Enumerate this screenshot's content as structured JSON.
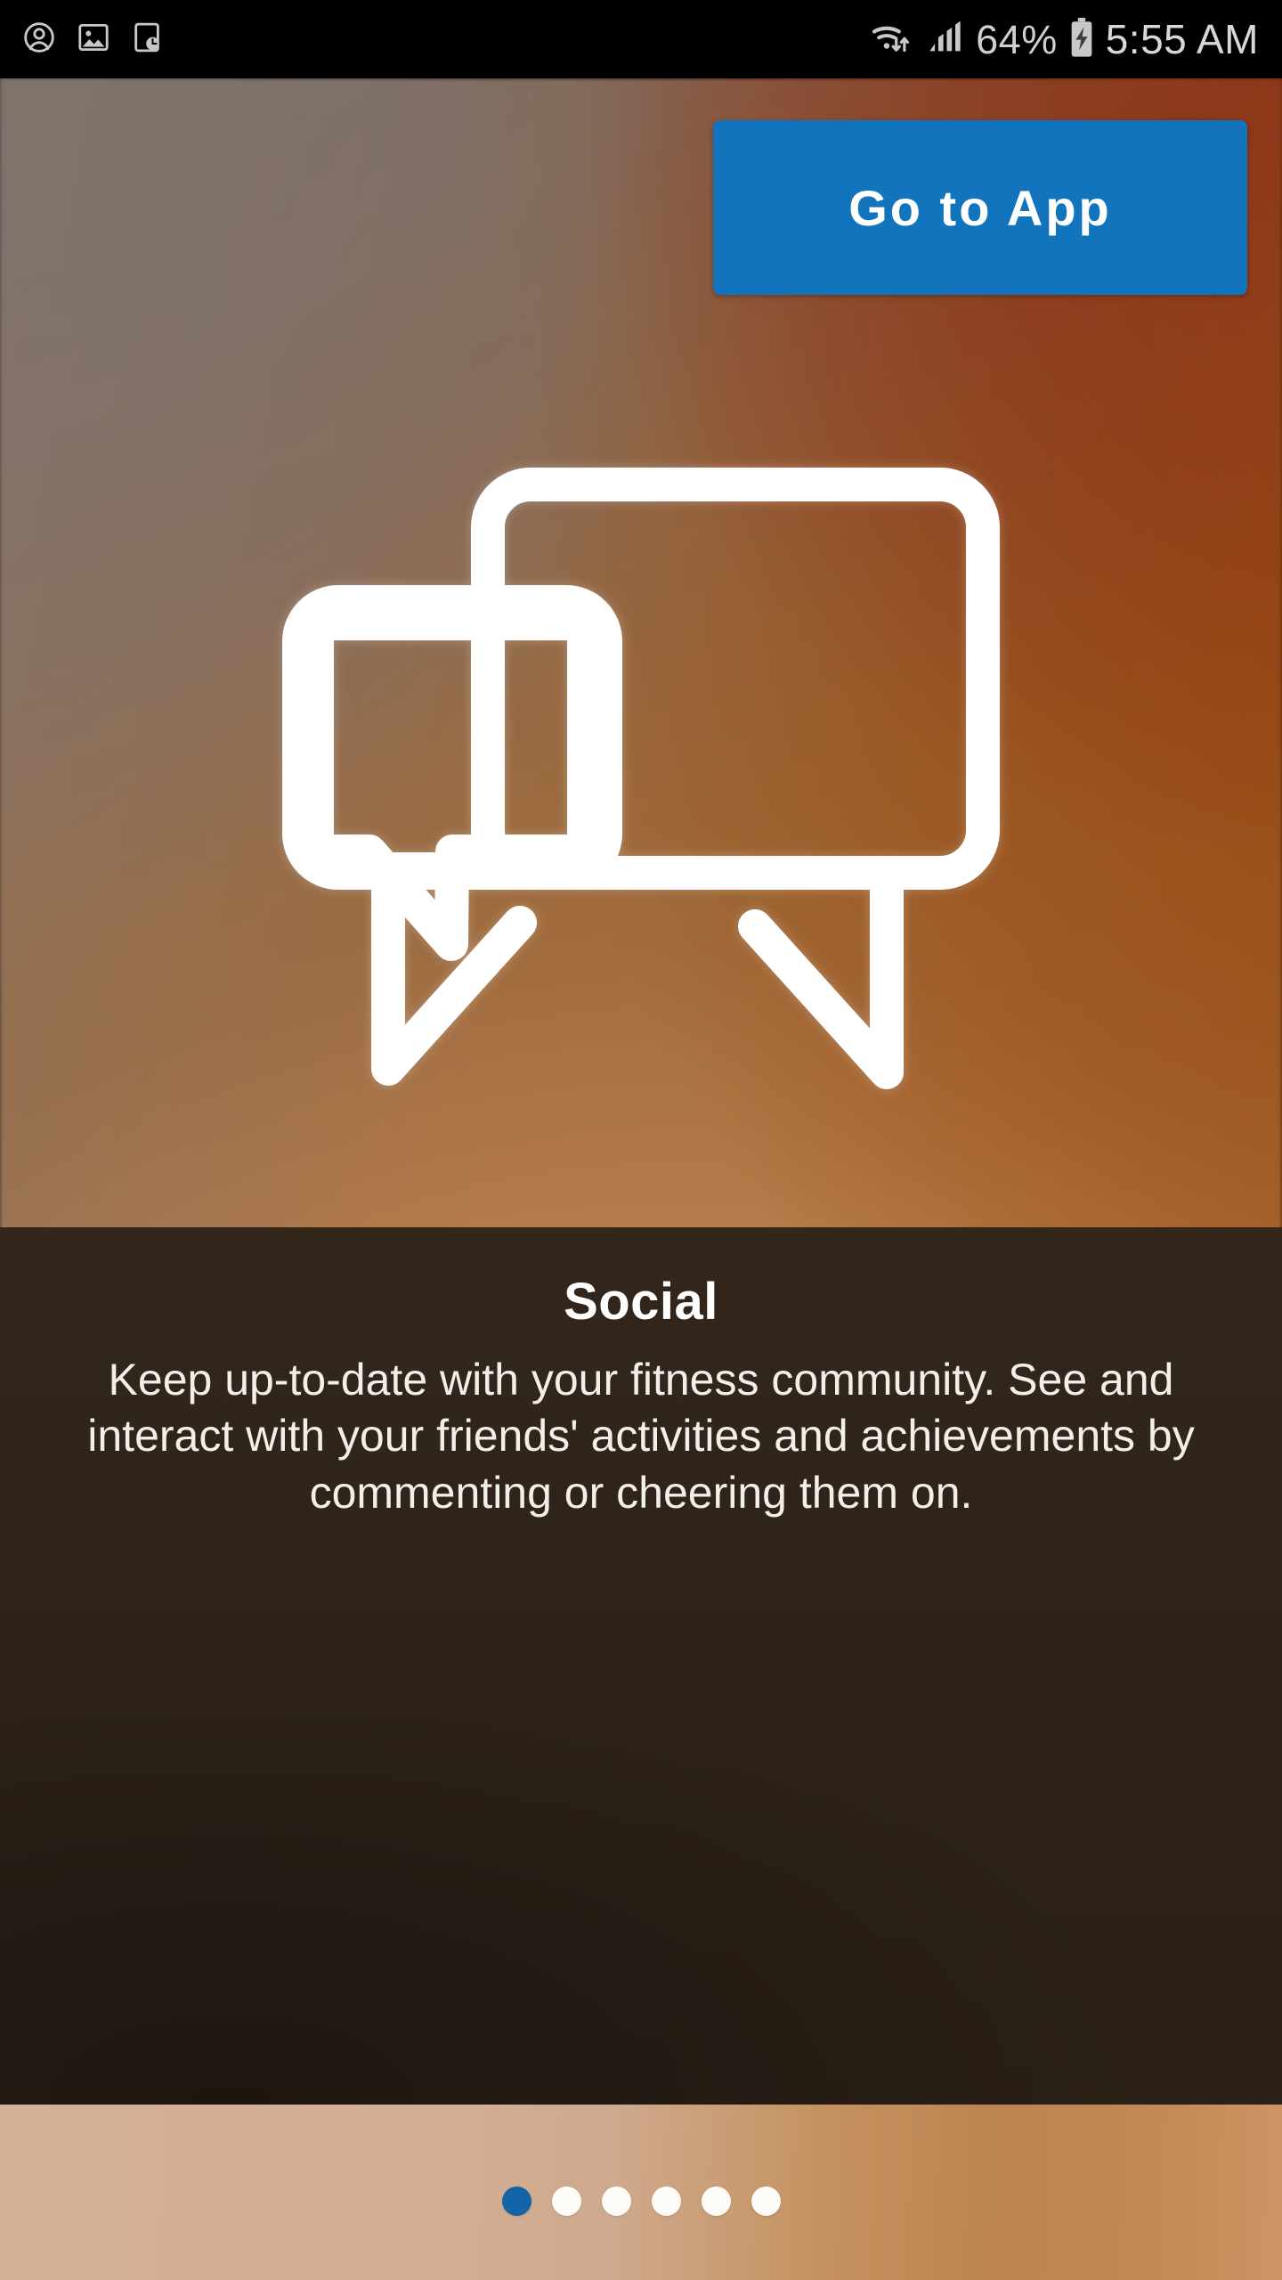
{
  "status_bar": {
    "left_icons": [
      {
        "name": "contact-account-icon",
        "label": "account"
      },
      {
        "name": "image-gallery-icon",
        "label": "screenshot"
      },
      {
        "name": "device-clock-icon",
        "label": "alarm"
      }
    ],
    "wifi_icon": "wifi-transfer-icon",
    "signal_icon": "cellular-signal-icon",
    "battery_percent": "64%",
    "battery_icon": "battery-charging-icon",
    "time": "5:55 AM"
  },
  "header": {
    "go_to_app_label": "Go to App"
  },
  "hero": {
    "icon_name": "chat-bubbles-icon"
  },
  "feature": {
    "title": "Social",
    "description": "Keep up-to-date with your fitness community. See and interact with your friends' activities and achievements by commenting or cheering them on."
  },
  "pagination": {
    "total": 6,
    "active_index": 0,
    "dots": [
      {
        "index": 0,
        "active": true
      },
      {
        "index": 1,
        "active": false
      },
      {
        "index": 2,
        "active": false
      },
      {
        "index": 3,
        "active": false
      },
      {
        "index": 4,
        "active": false
      },
      {
        "index": 5,
        "active": false
      }
    ]
  },
  "colors": {
    "accent_blue": "#1274bc",
    "active_dot": "#1464a8",
    "panel_dark": "#2e2319",
    "text_white": "#ffffff",
    "status_text": "#cfcfcf"
  }
}
